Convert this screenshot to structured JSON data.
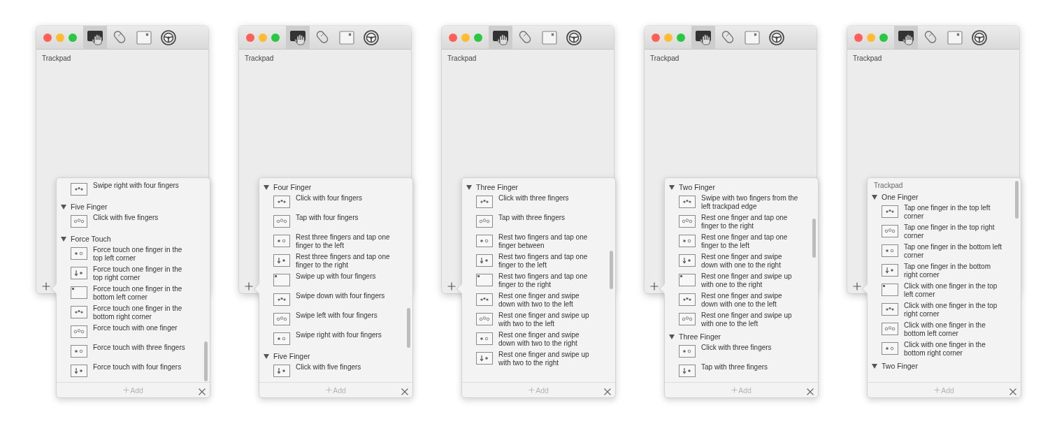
{
  "windows": [
    {
      "section_label": "Trackpad",
      "toolbar_tabs": [
        {
          "selected": true
        },
        {
          "selected": false
        },
        {
          "selected": false
        },
        {
          "selected": false
        }
      ],
      "popover": {
        "groups": [
          {
            "items": [
              "Swipe right with four fingers"
            ]
          },
          {
            "label": "Five Finger",
            "expanded": true,
            "items": [
              "Click with five fingers"
            ]
          },
          {
            "label": "Force Touch",
            "expanded": true,
            "items": [
              "Force touch one finger in the top left corner",
              "Force touch one finger in the top right corner",
              "Force touch one finger in the bottom left corner",
              "Force touch one finger in the bottom right corner",
              "Force touch with one finger",
              "Force touch with three fingers",
              "Force touch with four fingers"
            ]
          }
        ],
        "add_button": {
          "label": "Add",
          "disabled": true
        }
      }
    },
    {
      "section_label": "Trackpad",
      "toolbar_tabs": [
        {
          "selected": true
        },
        {
          "selected": false
        },
        {
          "selected": false
        },
        {
          "selected": false
        }
      ],
      "popover": {
        "groups": [
          {
            "label": "Four Finger",
            "expanded": true,
            "items": [
              "Click with four fingers",
              "Tap with four fingers",
              "Rest three fingers and tap one finger to the left",
              "Rest three fingers and tap one finger to the right",
              "Swipe up with four fingers",
              "Swipe down with four fingers",
              "Swipe left with four fingers",
              "Swipe right with four fingers"
            ]
          },
          {
            "label": "Five Finger",
            "expanded": true,
            "items": [
              "Click with five fingers"
            ]
          }
        ],
        "add_button": {
          "label": "Add",
          "disabled": true
        }
      }
    },
    {
      "section_label": "Trackpad",
      "toolbar_tabs": [
        {
          "selected": true
        },
        {
          "selected": false
        },
        {
          "selected": false
        },
        {
          "selected": false
        }
      ],
      "popover": {
        "groups": [
          {
            "label": "Three Finger",
            "expanded": true,
            "items": [
              "Click with three fingers",
              "Tap with three fingers",
              "Rest two fingers and tap one finger between",
              "Rest two fingers and tap one finger to the left",
              "Rest two fingers and tap one finger to the right",
              "Rest one finger and swipe down with two to the left",
              "Rest one finger and swipe up with two to the left",
              "Rest one finger and swipe down with two to the right",
              "Rest one finger and swipe up with two to the right"
            ]
          }
        ],
        "add_button": {
          "label": "Add",
          "disabled": true
        }
      }
    },
    {
      "section_label": "Trackpad",
      "toolbar_tabs": [
        {
          "selected": true
        },
        {
          "selected": false
        },
        {
          "selected": false
        },
        {
          "selected": false
        }
      ],
      "popover": {
        "groups": [
          {
            "label": "Two Finger",
            "expanded": true,
            "items": [
              "Swipe with two fingers from the left trackpad edge",
              "Rest one finger and tap one finger to the right",
              "Rest one finger and tap one finger to the left",
              "Rest one finger and swipe down with one to the right",
              "Rest one finger and swipe up with one to the right",
              "Rest one finger and swipe down with one to the left",
              "Rest one finger and swipe up with one to the left"
            ]
          },
          {
            "label": "Three Finger",
            "expanded": true,
            "items": [
              "Click with three fingers",
              "Tap with three fingers"
            ]
          }
        ],
        "add_button": {
          "label": "Add",
          "disabled": true
        }
      }
    },
    {
      "section_label": "Trackpad",
      "toolbar_tabs": [
        {
          "selected": true
        },
        {
          "selected": false
        },
        {
          "selected": false
        },
        {
          "selected": false
        }
      ],
      "popover": {
        "heading": "Trackpad",
        "groups": [
          {
            "label": "One Finger",
            "expanded": true,
            "items": [
              "Tap one finger in the top left corner",
              "Tap one finger in the top right corner",
              "Tap one finger in the bottom left corner",
              "Tap one finger in the bottom right corner",
              "Click with one finger in the top left corner",
              "Click with one finger in the top right corner",
              "Click with one finger in the bottom left corner",
              "Click with one finger in the bottom right corner"
            ]
          },
          {
            "label": "Two Finger",
            "expanded": true
          }
        ],
        "add_button": {
          "label": "Add",
          "disabled": true
        }
      }
    }
  ]
}
